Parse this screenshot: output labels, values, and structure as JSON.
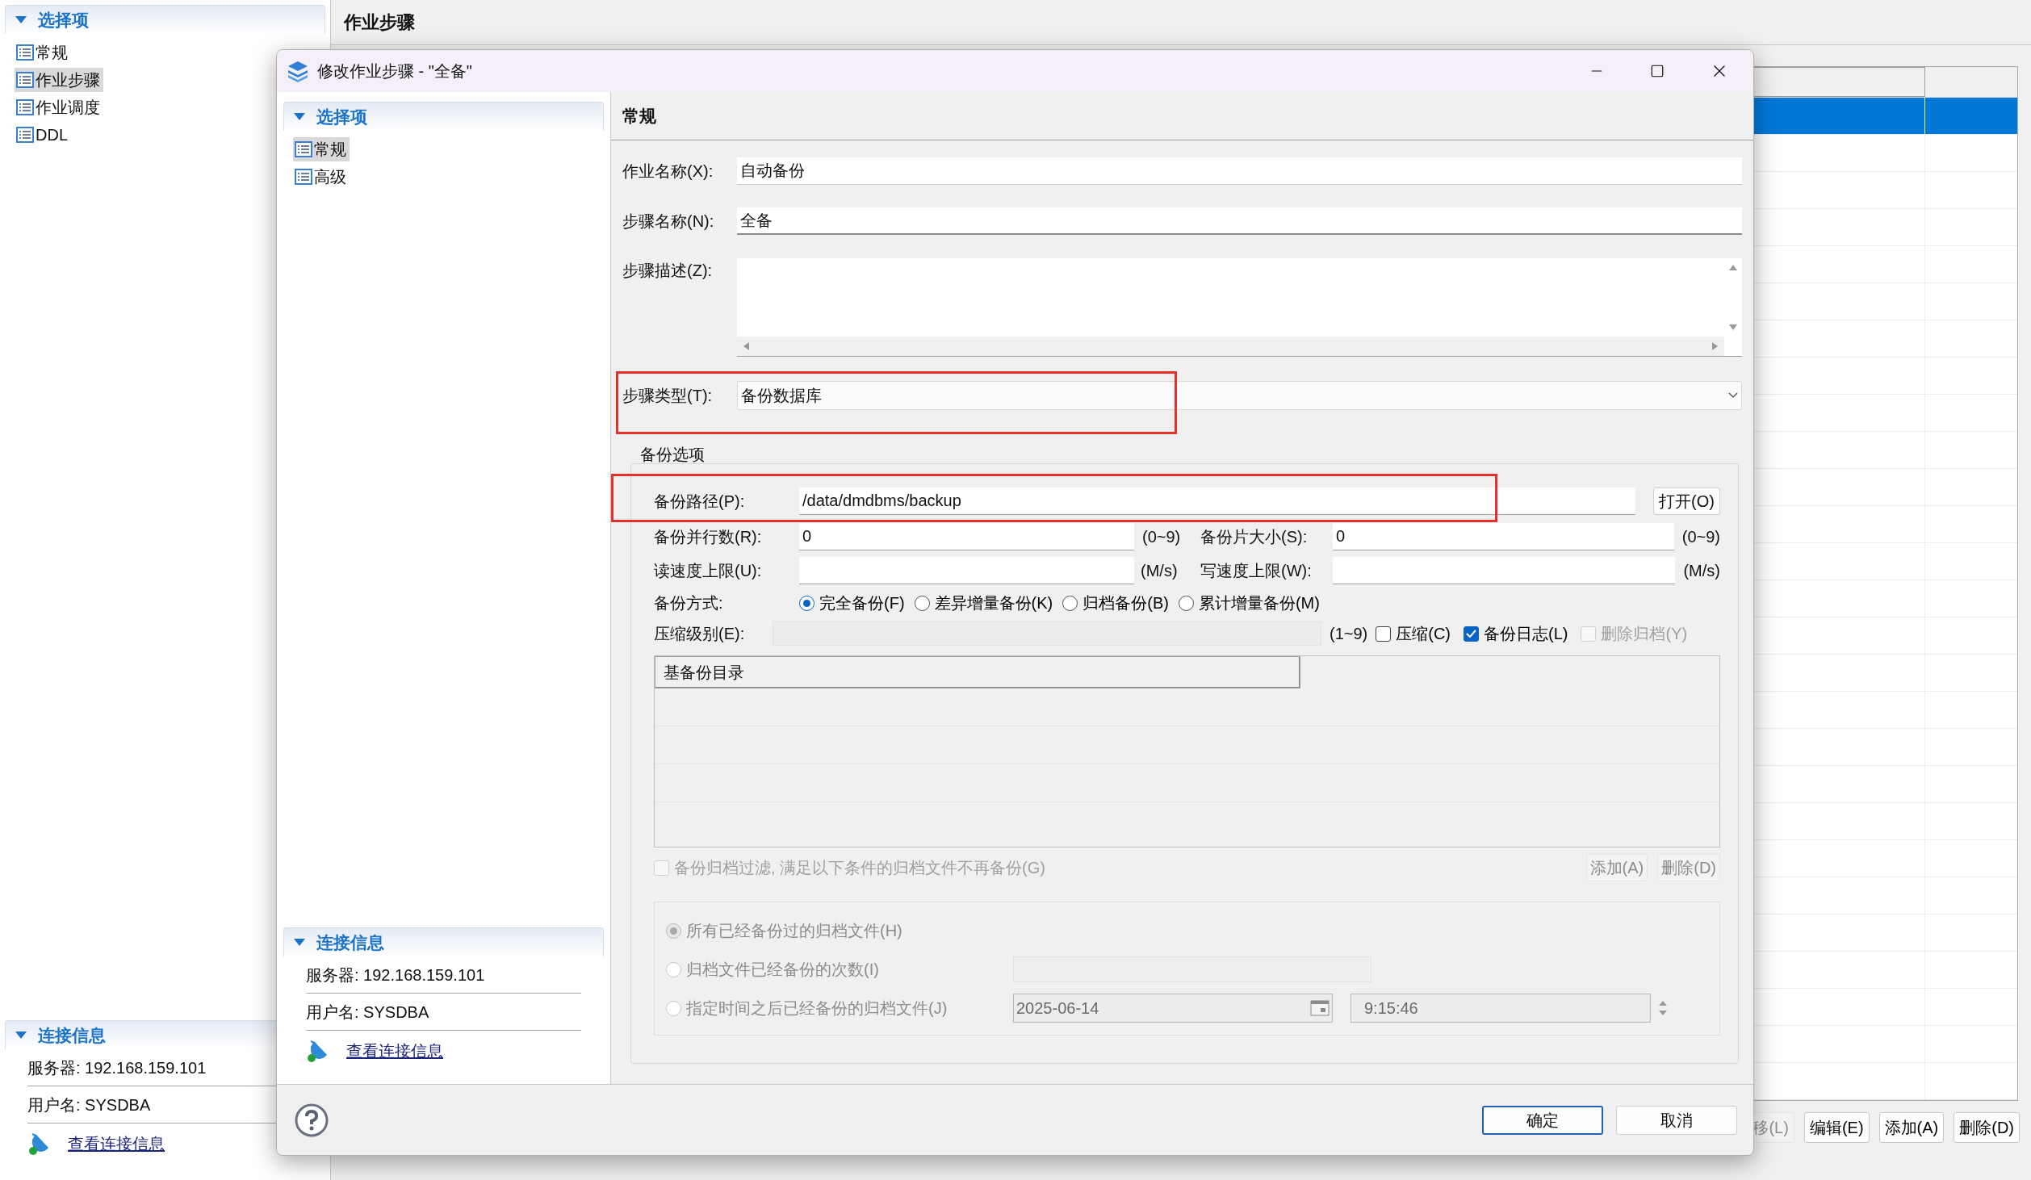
{
  "background": {
    "sidebar": {
      "title": "选择项",
      "items": [
        {
          "label": "常规",
          "selected": false
        },
        {
          "label": "作业步骤",
          "selected": true
        },
        {
          "label": "作业调度",
          "selected": false
        },
        {
          "label": "DDL",
          "selected": false
        }
      ]
    },
    "connection": {
      "title": "连接信息",
      "server": "服务器: 192.168.159.101",
      "user": "用户名: SYSDBA",
      "link": "查看连接信息"
    },
    "page_title": "作业步骤",
    "table": {
      "rows": [
        {
          "selected": true
        },
        {
          "selected": false
        },
        {
          "selected": false
        },
        {
          "selected": false
        },
        {
          "selected": false
        },
        {
          "selected": false
        },
        {
          "selected": false
        },
        {
          "selected": false
        },
        {
          "selected": false
        },
        {
          "selected": false
        },
        {
          "selected": false
        },
        {
          "selected": false
        },
        {
          "selected": false
        },
        {
          "selected": false
        },
        {
          "selected": false
        },
        {
          "selected": false
        },
        {
          "selected": false
        },
        {
          "selected": false
        },
        {
          "selected": false
        },
        {
          "selected": false
        },
        {
          "selected": false
        },
        {
          "selected": false
        },
        {
          "selected": false
        },
        {
          "selected": false
        },
        {
          "selected": false
        },
        {
          "selected": false
        },
        {
          "selected": false
        }
      ]
    },
    "buttons": [
      {
        "label": "移(L)",
        "disabled": true
      },
      {
        "label": "编辑(E)",
        "disabled": false
      },
      {
        "label": "添加(A)",
        "disabled": false
      },
      {
        "label": "删除(D)",
        "disabled": false
      }
    ]
  },
  "dialog": {
    "title": "修改作业步骤 - \"全备\"",
    "sidebar": {
      "title": "选择项",
      "items": [
        {
          "label": "常规",
          "selected": true
        },
        {
          "label": "高级",
          "selected": false
        }
      ]
    },
    "connection": {
      "title": "连接信息",
      "server": "服务器: 192.168.159.101",
      "user": "用户名: SYSDBA",
      "link": "查看连接信息"
    },
    "section_title": "常规",
    "fields": [
      {
        "kind": "readonly",
        "label": "作业名称(X):",
        "value": "自动备份"
      },
      {
        "kind": "text",
        "label": "步骤名称(N):",
        "value": "全备"
      },
      {
        "kind": "textarea",
        "label": "步骤描述(Z):"
      },
      {
        "kind": "select",
        "label": "步骤类型(T):",
        "value": "备份数据库"
      }
    ],
    "backup_options": {
      "title": "备份选项",
      "path": {
        "label": "备份路径(P):",
        "value": "/data/dmdbms/backup",
        "button": "打开(O)"
      },
      "parallel": {
        "label": "备份并行数(R):",
        "value": "0",
        "range": "(0~9)"
      },
      "piece_size": {
        "label": "备份片大小(S):",
        "value": "0",
        "range": "(0~9)"
      },
      "read_limit": {
        "label": "读速度上限(U):",
        "unit": "(M/s)"
      },
      "write_limit": {
        "label": "写速度上限(W):",
        "unit": "(M/s)"
      },
      "mode": {
        "label": "备份方式:",
        "options": [
          {
            "label": "完全备份(F)",
            "selected": true
          },
          {
            "label": "差异增量备份(K)",
            "selected": false
          },
          {
            "label": "归档备份(B)",
            "selected": false
          },
          {
            "label": "累计增量备份(M)",
            "selected": false
          }
        ]
      },
      "compress_level": {
        "label": "压缩级别(E):",
        "range": "(1~9)"
      },
      "checkboxes": [
        {
          "label": "压缩(C)",
          "checked": false,
          "disabled": false
        },
        {
          "label": "备份日志(L)",
          "checked": true,
          "disabled": false
        },
        {
          "label": "删除归档(Y)",
          "checked": false,
          "disabled": true
        }
      ],
      "base_table": {
        "column": "基备份目录"
      },
      "filter": {
        "label": "备份归档过滤, 满足以下条件的归档文件不再备份(G)",
        "checked": false,
        "disabled": true
      },
      "filter_buttons": [
        {
          "label": "添加(A)",
          "disabled": true
        },
        {
          "label": "删除(D)",
          "disabled": true
        }
      ],
      "filter_options": [
        {
          "kind": "plain",
          "label": "所有已经备份过的归档文件(H)",
          "selected": true
        },
        {
          "kind": "count",
          "label": "归档文件已经备份的次数(I)",
          "selected": false
        },
        {
          "kind": "datetime",
          "label": "指定时间之后已经备份的归档文件(J)",
          "selected": false,
          "date": "2025-06-14",
          "time": "9:15:46"
        }
      ]
    },
    "buttons": [
      {
        "label": "确定",
        "default": true
      },
      {
        "label": "取消",
        "default": false
      }
    ]
  }
}
